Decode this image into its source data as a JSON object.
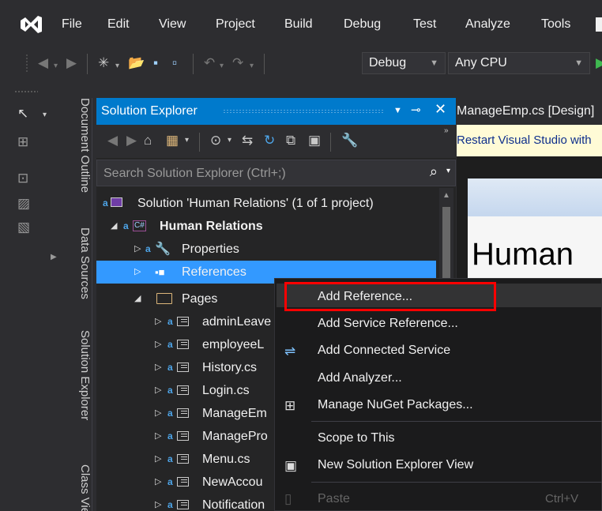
{
  "menu": {
    "items": [
      "File",
      "Edit",
      "View",
      "Project",
      "Build",
      "Debug",
      "Test",
      "Analyze",
      "Tools"
    ]
  },
  "toolbar": {
    "configuration": "Debug",
    "platform": "Any CPU"
  },
  "side_tabs": {
    "document_outline": "Document Outline",
    "data_sources": "Data Sources",
    "solution_explorer": "Solution Explorer",
    "class_view": "Class View"
  },
  "solution_explorer": {
    "title": "Solution Explorer",
    "search_placeholder": "Search Solution Explorer (Ctrl+;)",
    "tree": {
      "solution": "Solution 'Human Relations' (1 of 1 project)",
      "project": "Human Relations",
      "properties": "Properties",
      "references": "References",
      "pages": "Pages",
      "files": [
        "adminLeave",
        "employeeL",
        "History.cs",
        "Login.cs",
        "ManageEm",
        "ManagePro",
        "Menu.cs",
        "NewAccou",
        "Notification"
      ]
    }
  },
  "editor": {
    "tab": "ManageEmp.cs [Design]",
    "infobar": "Restart Visual Studio with",
    "designer_heading": "Human"
  },
  "context_menu": {
    "add_reference": "Add Reference...",
    "add_service_reference": "Add Service Reference...",
    "add_connected_service": "Add Connected Service",
    "add_analyzer": "Add Analyzer...",
    "manage_nuget": "Manage NuGet Packages...",
    "scope_to_this": "Scope to This",
    "new_view": "New Solution Explorer View",
    "paste": "Paste",
    "paste_shortcut": "Ctrl+V"
  },
  "colors": {
    "accent": "#007acc",
    "selection": "#3399ff",
    "highlight_box": "#ff0000"
  }
}
